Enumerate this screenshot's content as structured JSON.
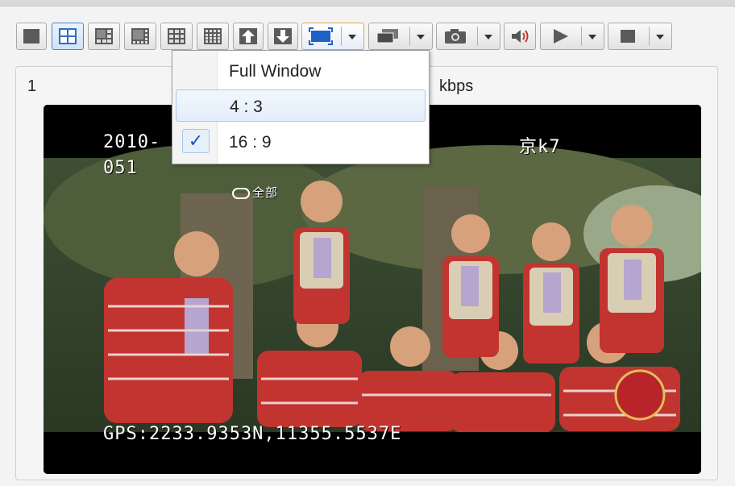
{
  "toolbar": {
    "buttons": [
      {
        "name": "layout-1-button"
      },
      {
        "name": "layout-4-button"
      },
      {
        "name": "layout-6-button"
      },
      {
        "name": "layout-8-button"
      },
      {
        "name": "layout-9-button"
      },
      {
        "name": "layout-16-button"
      },
      {
        "name": "previous-page-button"
      },
      {
        "name": "next-page-button"
      },
      {
        "name": "aspect-ratio-dropdown"
      },
      {
        "name": "window-mode-dropdown"
      },
      {
        "name": "snapshot-dropdown"
      },
      {
        "name": "audio-button"
      },
      {
        "name": "play-dropdown"
      },
      {
        "name": "stop-dropdown"
      }
    ]
  },
  "panel": {
    "channel_number": "1",
    "bitrate_suffix": "kbps"
  },
  "video": {
    "osd_top_left": "2010-",
    "osd_second_line": "051",
    "osd_top_right": "京k7",
    "osd_logo_text": "全部",
    "osd_gps": "GPS:2233.9353N,11355.5537E"
  },
  "aspect_menu": {
    "items": [
      {
        "label": "Full Window",
        "state": "normal"
      },
      {
        "label": "4 : 3",
        "state": "hover"
      },
      {
        "label": "16 : 9",
        "state": "checked"
      }
    ],
    "check_glyph": "✓"
  },
  "colors": {
    "accent_border": "#e0a94a",
    "menu_highlight": "#a9c6e6",
    "check_color": "#1a57b8"
  }
}
